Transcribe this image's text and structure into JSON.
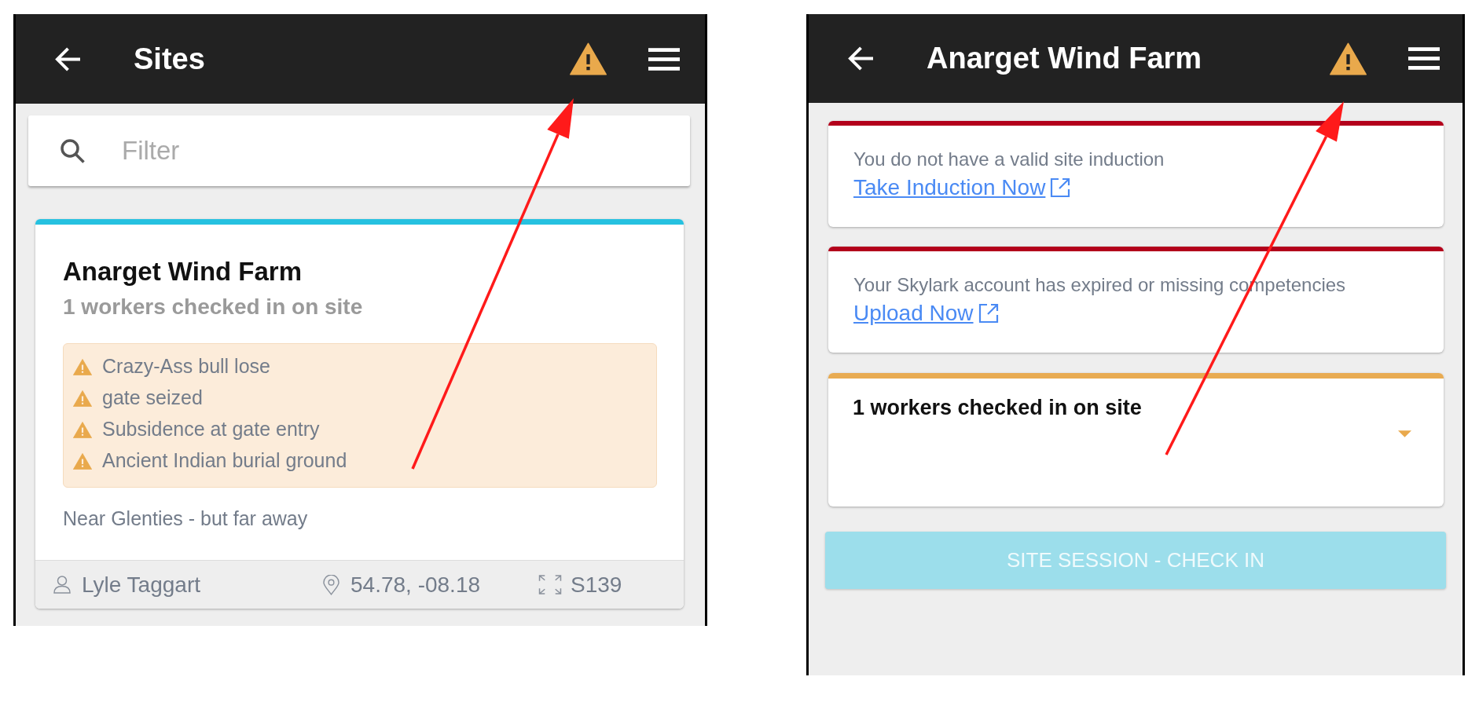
{
  "sites_screen": {
    "header": {
      "title": "Sites"
    },
    "filter": {
      "placeholder": "Filter"
    },
    "sites": [
      {
        "name": "Anarget Wind Farm",
        "color": "#26c1e0",
        "workers": "1 workers checked in on site",
        "hazards": [
          "Crazy-Ass bull lose",
          "gate seized",
          "Subsidence at gate entry",
          "Ancient Indian burial ground"
        ],
        "description": "Near Glenties - but far away",
        "contact": "Lyle Taggart",
        "coordinates": "54.78, -08.18",
        "site_code": "S139"
      }
    ]
  },
  "site_detail_screen": {
    "header": {
      "title": "Anarget Wind Farm"
    },
    "panels": [
      {
        "kind": "alert",
        "color": "#b3001b",
        "message": "You do not have a valid site induction",
        "link": "Take Induction Now"
      },
      {
        "kind": "alert",
        "color": "#b3001b",
        "message": "Your Skylark account has expired or missing competencies",
        "link": "Upload Now"
      },
      {
        "kind": "workers",
        "color": "#e8ab52",
        "title": "1 workers checked in on site",
        "expanded": false
      }
    ],
    "check_in_button": {
      "label": "SITE SESSION - CHECK IN",
      "disabled": true
    }
  }
}
